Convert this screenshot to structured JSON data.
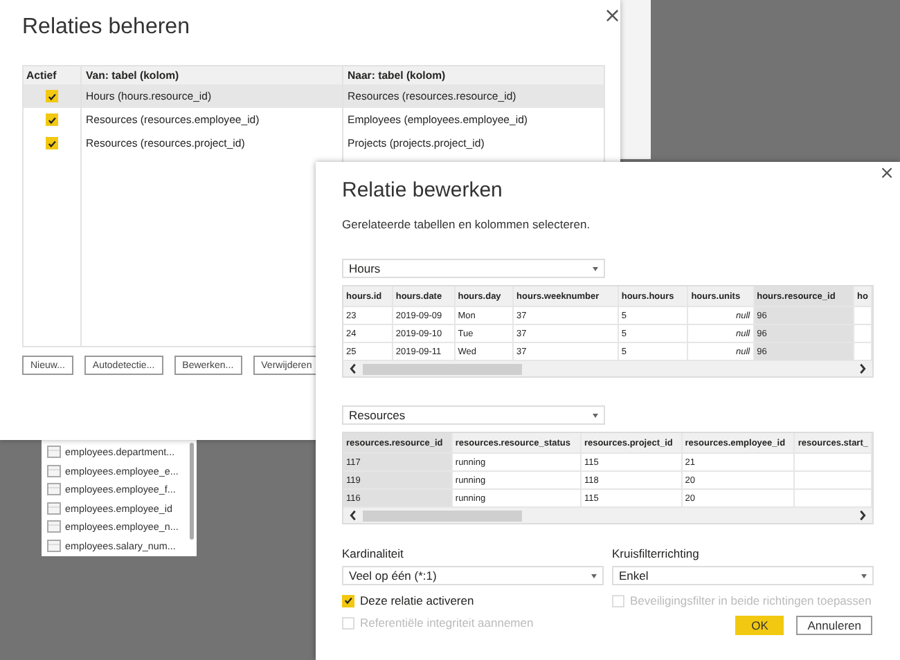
{
  "field_list": {
    "items": [
      "employees.department...",
      "employees.employee_e...",
      "employees.employee_f...",
      "employees.employee_id",
      "employees.employee_n...",
      "employees.salary_num..."
    ]
  },
  "manage_dialog": {
    "title": "Relaties beheren",
    "close": "×",
    "columns": [
      "Actief",
      "Van: tabel (kolom)",
      "Naar: tabel (kolom)"
    ],
    "rows": [
      {
        "active": true,
        "selected": true,
        "from": "Hours (hours.resource_id)",
        "to": "Resources (resources.resource_id)"
      },
      {
        "active": true,
        "selected": false,
        "from": "Resources (resources.employee_id)",
        "to": "Employees (employees.employee_id)"
      },
      {
        "active": true,
        "selected": false,
        "from": "Resources (resources.project_id)",
        "to": "Projects (projects.project_id)"
      }
    ],
    "buttons": [
      "Nieuw...",
      "Autodetectie...",
      "Bewerken...",
      "Verwijderen"
    ]
  },
  "edit_dialog": {
    "title": "Relatie bewerken",
    "close": "×",
    "subtitle": "Gerelateerde tabellen en kolommen selecteren.",
    "tables": [
      {
        "dropdown": "Hours",
        "columns": [
          {
            "label": "hours.id",
            "selected": false
          },
          {
            "label": "hours.date",
            "selected": false
          },
          {
            "label": "hours.day",
            "selected": false
          },
          {
            "label": "hours.weeknumber",
            "selected": false
          },
          {
            "label": "hours.hours",
            "selected": false
          },
          {
            "label": "hours.units",
            "selected": false
          },
          {
            "label": "hours.resource_id",
            "selected": true
          },
          {
            "label": "ho",
            "selected": false
          }
        ],
        "rows": [
          [
            "23",
            "2019-09-09",
            "Mon",
            "37",
            "5",
            "null",
            "96",
            ""
          ],
          [
            "24",
            "2019-09-10",
            "Tue",
            "37",
            "5",
            "null",
            "96",
            ""
          ],
          [
            "25",
            "2019-09-11",
            "Wed",
            "37",
            "5",
            "null",
            "96",
            ""
          ]
        ]
      },
      {
        "dropdown": "Resources",
        "columns": [
          {
            "label": "resources.resource_id",
            "selected": true
          },
          {
            "label": "resources.resource_status",
            "selected": false
          },
          {
            "label": "resources.project_id",
            "selected": false
          },
          {
            "label": "resources.employee_id",
            "selected": false
          },
          {
            "label": "resources.start_",
            "selected": false
          }
        ],
        "rows": [
          [
            "117",
            "running",
            "115",
            "21",
            ""
          ],
          [
            "119",
            "running",
            "118",
            "20",
            ""
          ],
          [
            "116",
            "running",
            "115",
            "20",
            ""
          ]
        ]
      }
    ],
    "cardinality": {
      "label": "Kardinaliteit",
      "value": "Veel op één (*:1)"
    },
    "crossfilter": {
      "label": "Kruisfilterrichting",
      "value": "Enkel"
    },
    "options_left": [
      {
        "label": "Deze relatie activeren",
        "checked": true,
        "disabled": false
      },
      {
        "label": "Referentiële integriteit aannemen",
        "checked": false,
        "disabled": true
      }
    ],
    "options_right": [
      {
        "label": "Beveiligingsfilter in beide richtingen toepassen",
        "checked": false,
        "disabled": true
      }
    ],
    "buttons": [
      {
        "label": "OK",
        "kind": "primary"
      },
      {
        "label": "Annuleren",
        "kind": "secondary"
      }
    ]
  }
}
